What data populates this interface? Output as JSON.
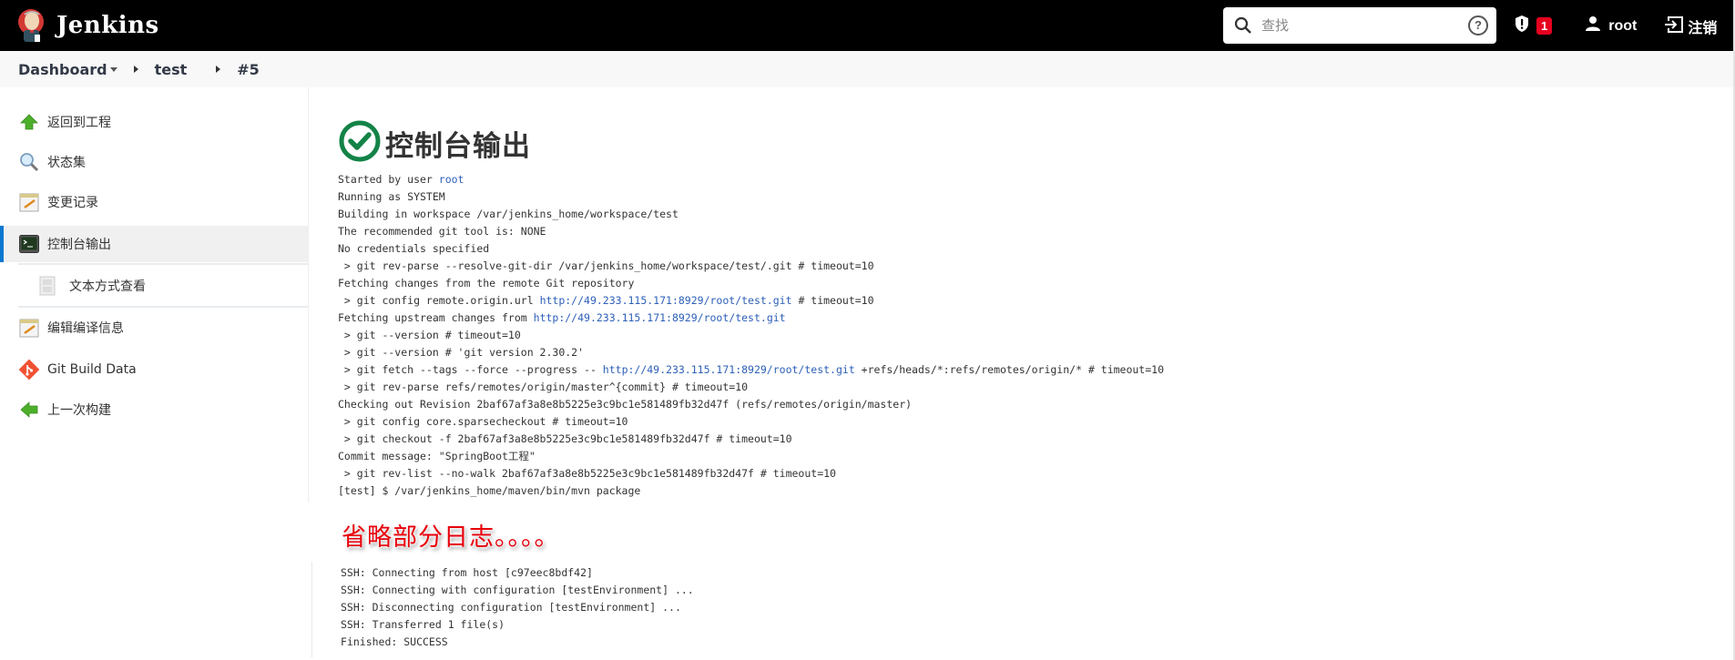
{
  "header": {
    "app_name": "Jenkins",
    "search_placeholder": "查找",
    "search_value": "",
    "security_badge_count": "1",
    "user_name": "root",
    "logout_label": "注销",
    "icons": [
      "jenkins-logo-icon",
      "search-icon",
      "help-icon",
      "shield-alert-icon",
      "user-icon",
      "logout-icon"
    ]
  },
  "breadcrumb": {
    "items": [
      "Dashboard",
      "test",
      "#5"
    ]
  },
  "sidebar": {
    "items": [
      {
        "label": "返回到工程",
        "icon": "up-arrow-icon"
      },
      {
        "label": "状态集",
        "icon": "magnifier-icon"
      },
      {
        "label": "变更记录",
        "icon": "notepad-icon"
      },
      {
        "label": "控制台输出",
        "icon": "terminal-icon",
        "active": true
      },
      {
        "label": "文本方式查看",
        "icon": "document-icon",
        "sub": true
      },
      {
        "label": "编辑编译信息",
        "icon": "notepad-icon"
      },
      {
        "label": "Git Build Data",
        "icon": "git-icon"
      },
      {
        "label": "上一次构建",
        "icon": "left-arrow-icon"
      }
    ]
  },
  "main": {
    "title": "控制台输出",
    "status": "success",
    "accent_color": "#138347",
    "console_lines": [
      {
        "text": "Started by user ",
        "link": "root",
        "after": ""
      },
      {
        "text": "Running as SYSTEM"
      },
      {
        "text": "Building in workspace /var/jenkins_home/workspace/test"
      },
      {
        "text": "The recommended git tool is: NONE"
      },
      {
        "text": "No credentials specified"
      },
      {
        "text": " > git rev-parse --resolve-git-dir /var/jenkins_home/workspace/test/.git # timeout=10"
      },
      {
        "text": "Fetching changes from the remote Git repository"
      },
      {
        "text": " > git config remote.origin.url ",
        "link": "http://49.233.115.171:8929/root/test.git",
        "after": " # timeout=10"
      },
      {
        "text": "Fetching upstream changes from ",
        "link": "http://49.233.115.171:8929/root/test.git",
        "after": ""
      },
      {
        "text": " > git --version # timeout=10"
      },
      {
        "text": " > git --version # 'git version 2.30.2'"
      },
      {
        "text": " > git fetch --tags --force --progress -- ",
        "link": "http://49.233.115.171:8929/root/test.git",
        "after": " +refs/heads/*:refs/remotes/origin/* # timeout=10"
      },
      {
        "text": " > git rev-parse refs/remotes/origin/master^{commit} # timeout=10"
      },
      {
        "text": "Checking out Revision 2baf67af3a8e8b5225e3c9bc1e581489fb32d47f (refs/remotes/origin/master)"
      },
      {
        "text": " > git config core.sparsecheckout # timeout=10"
      },
      {
        "text": " > git checkout -f 2baf67af3a8e8b5225e3c9bc1e581489fb32d47f # timeout=10"
      },
      {
        "text": "Commit message: \"SpringBoot工程\""
      },
      {
        "text": " > git rev-list --no-walk 2baf67af3a8e8b5225e3c9bc1e581489fb32d47f # timeout=10"
      },
      {
        "text": "[test] $ /var/jenkins_home/maven/bin/mvn package"
      }
    ],
    "annotation": "省略部分日志。。。。",
    "console_tail": [
      "SSH: Connecting from host [c97eec8bdf42]",
      "SSH: Connecting with configuration [testEnvironment] ...",
      "SSH: Disconnecting configuration [testEnvironment] ...",
      "SSH: Transferred 1 file(s)",
      "Finished: SUCCESS"
    ]
  }
}
